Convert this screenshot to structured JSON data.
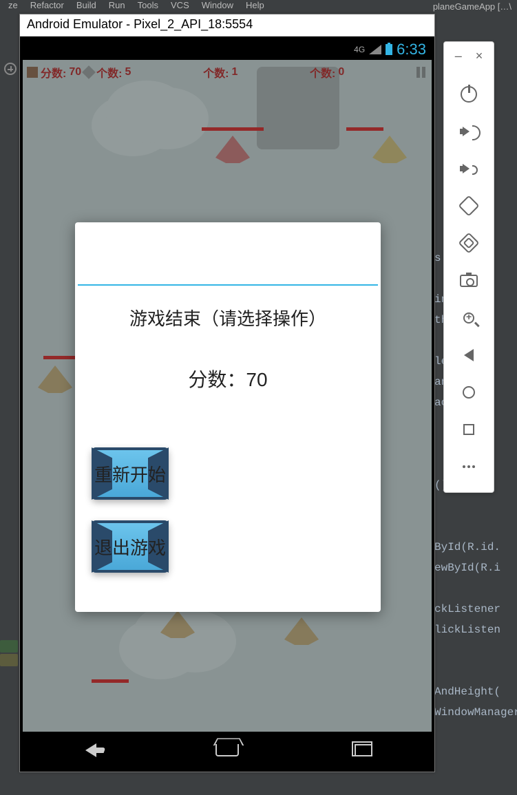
{
  "ide": {
    "menu": [
      "ze",
      "Refactor",
      "Build",
      "Run",
      "Tools",
      "VCS",
      "Window",
      "Help"
    ],
    "project_tab": "planeGameApp […\\",
    "code_right": "s A\n\ning\nth,s\n\nle\nanc\nact\n\n\n\n();\n\n\nById(R.id.\newById(R.i\n\nckListener\nlickListen\n\n\nAndHeight(\nWindowManager windowManager"
  },
  "emulator": {
    "title": "Android Emulator - Pixel_2_API_18:5554",
    "status": {
      "net": "4G",
      "charge_icon": "⚡",
      "time": "6:33"
    },
    "toolbar": {
      "minimize": "–",
      "close": "×",
      "buttons": [
        "power",
        "volume-up",
        "volume-down",
        "rotate-left",
        "rotate-right",
        "camera",
        "zoom",
        "back",
        "home",
        "overview",
        "more"
      ]
    }
  },
  "game": {
    "hud": {
      "score_label": "分数:",
      "score_value": "70",
      "count_label": "个数:",
      "counts": [
        "5",
        "1",
        "0"
      ]
    },
    "dialog": {
      "title": "游戏结束（请选择操作）",
      "score_prefix": "分数：",
      "score": "70",
      "restart": "重新开始",
      "exit": "退出游戏"
    }
  }
}
